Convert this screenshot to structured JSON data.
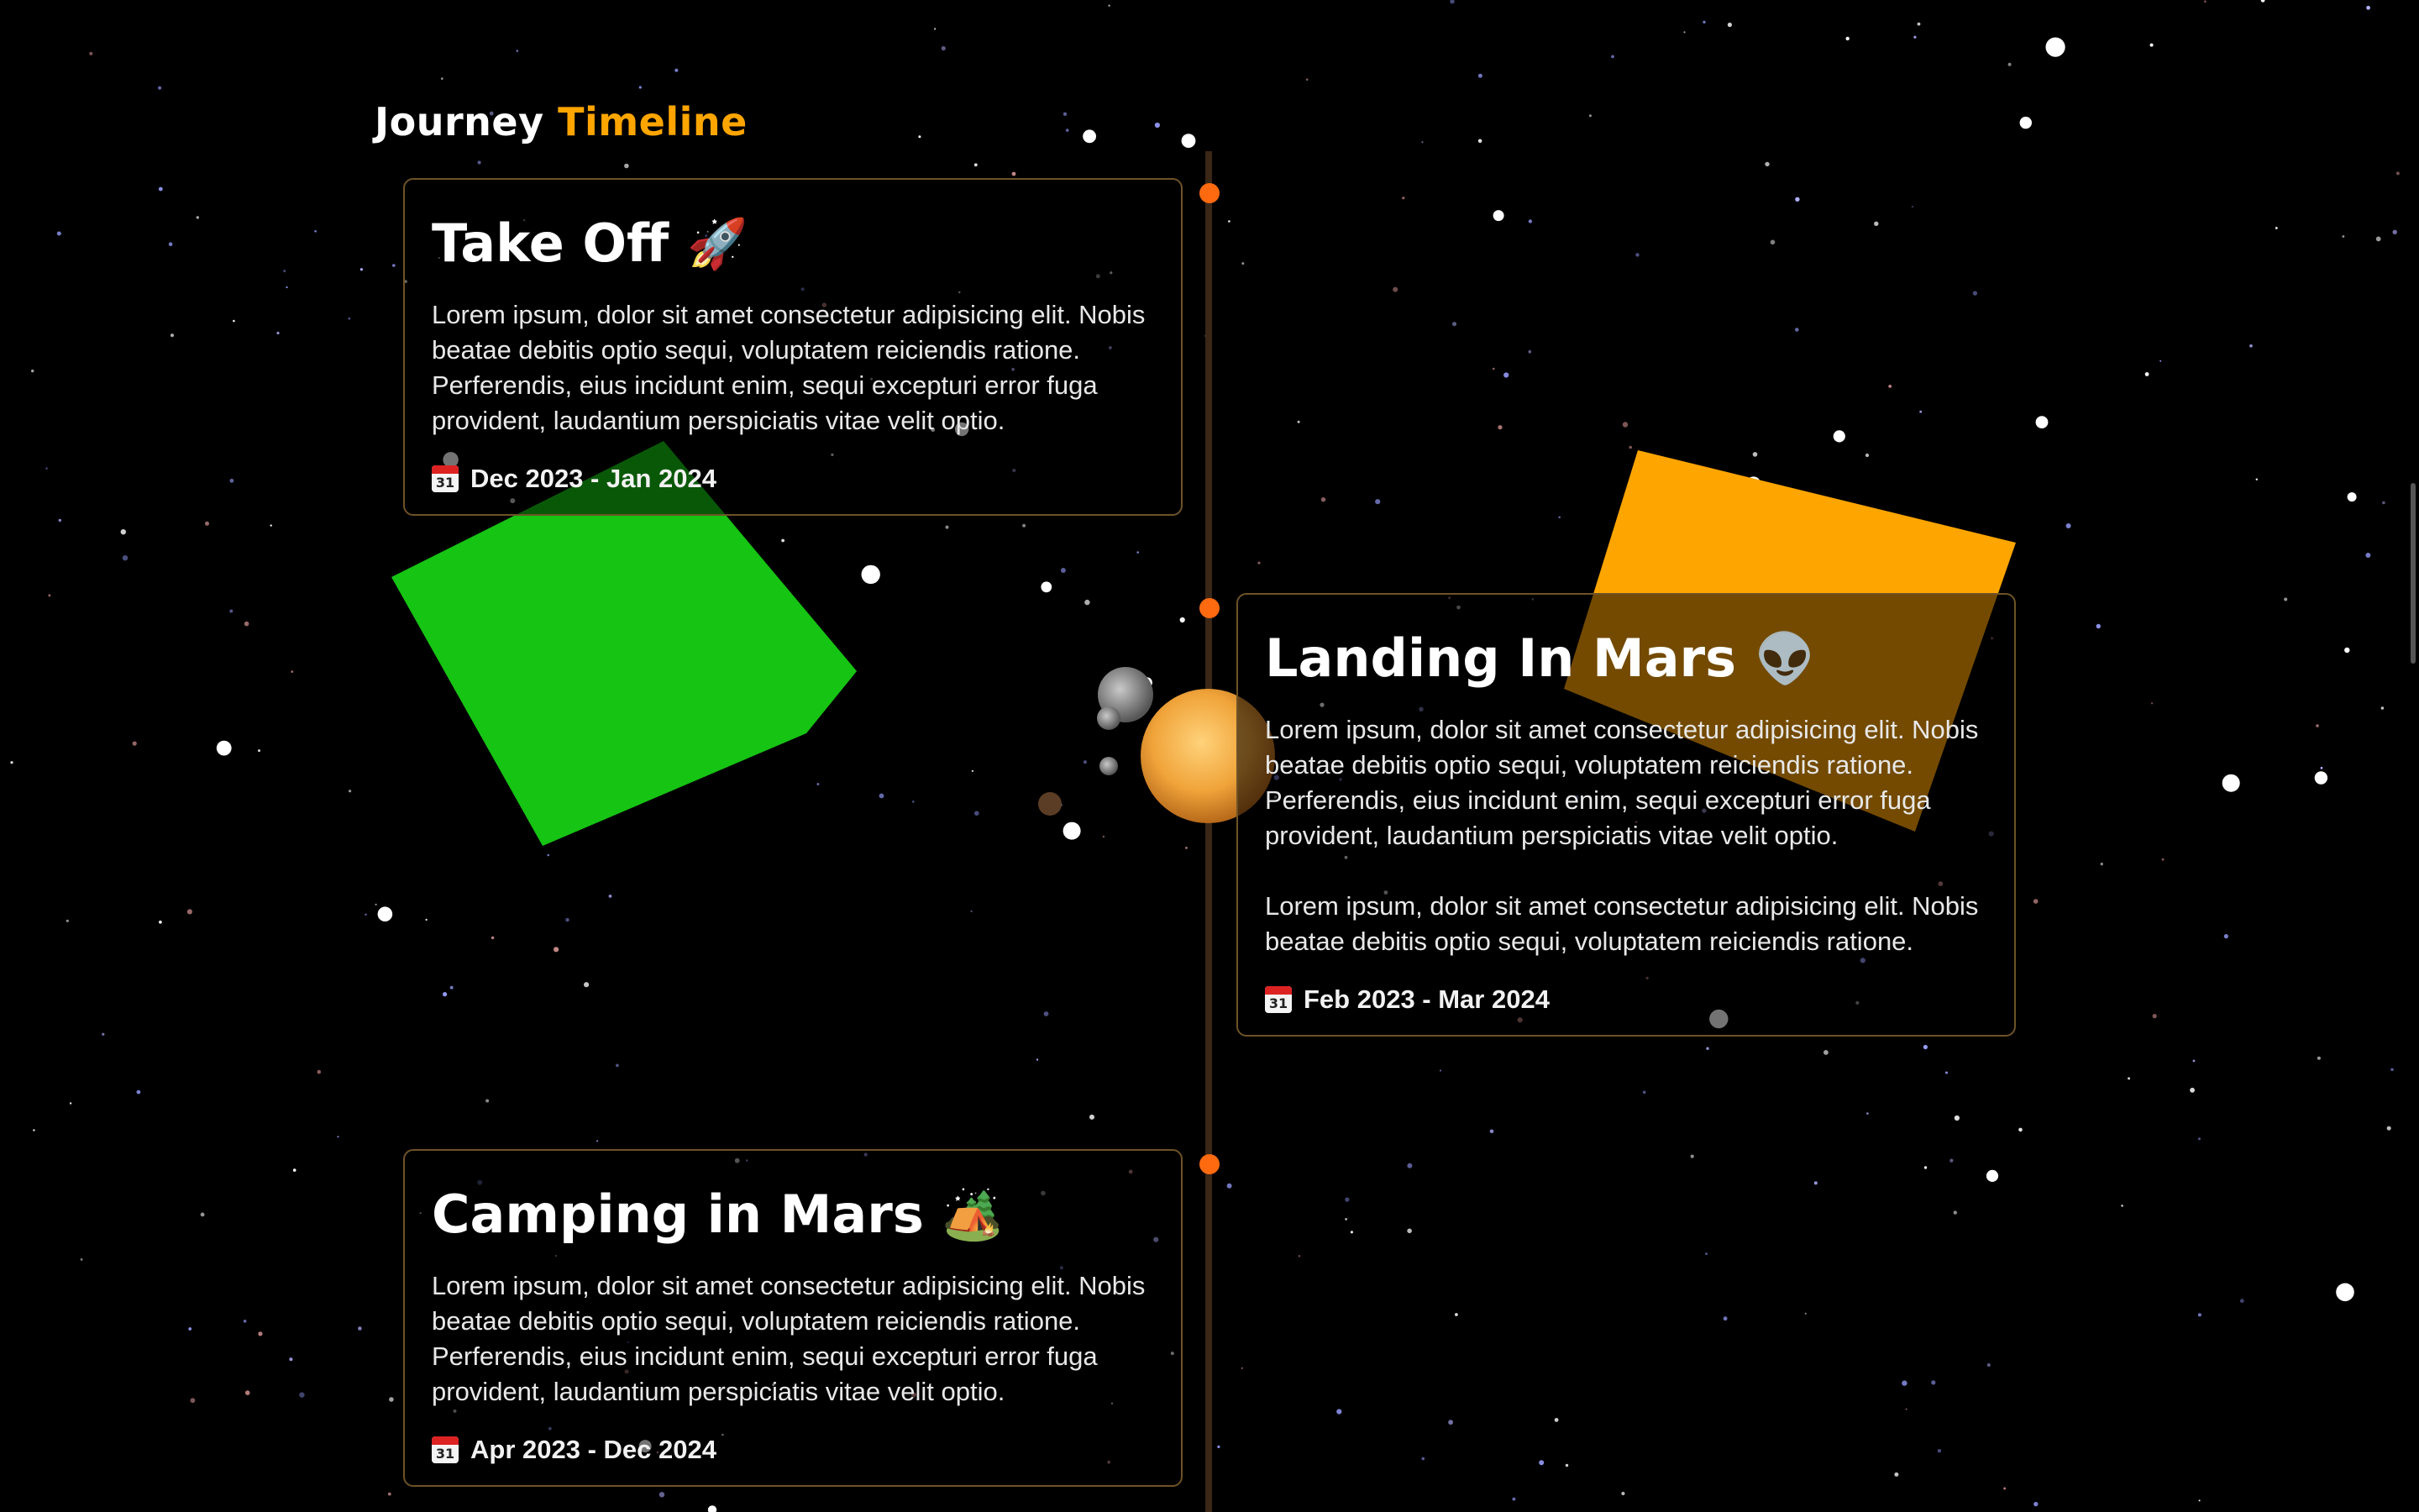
{
  "title": {
    "main": "Journey",
    "accent": "Timeline"
  },
  "colors": {
    "accent": "#ffa500",
    "dot": "#ff6a10",
    "green_shape": "#16c413",
    "orange_shape": "#ffa500",
    "card_border": "#6e5327"
  },
  "entries": [
    {
      "title": "Take Off",
      "emoji": "🚀",
      "paragraphs": [
        "Lorem ipsum, dolor sit amet consectetur adipisicing elit. Nobis beatae debitis optio sequi, voluptatem reiciendis ratione. Perferendis, eius incidunt enim, sequi excepturi error fuga provident, laudantium perspiciatis vitae velit optio."
      ],
      "date": "Dec 2023 - Jan 2024",
      "date_icon": "calendar-icon"
    },
    {
      "title": "Landing In Mars",
      "emoji": "👽",
      "paragraphs": [
        "Lorem ipsum, dolor sit amet consectetur adipisicing elit. Nobis beatae debitis optio sequi, voluptatem reiciendis ratione. Perferendis, eius incidunt enim, sequi excepturi error fuga provident, laudantium perspiciatis vitae velit optio.",
        "Lorem ipsum, dolor sit amet consectetur adipisicing elit. Nobis beatae debitis optio sequi, voluptatem reiciendis ratione."
      ],
      "date": "Feb 2023 - Mar 2024",
      "date_icon": "calendar-icon"
    },
    {
      "title": "Camping in Mars",
      "emoji": "🏕️",
      "paragraphs": [
        "Lorem ipsum, dolor sit amet consectetur adipisicing elit. Nobis beatae debitis optio sequi, voluptatem reiciendis ratione. Perferendis, eius incidunt enim, sequi excepturi error fuga provident, laudantium perspiciatis vitae velit optio."
      ],
      "date": "Apr 2023 - Dec 2024",
      "date_icon": "calendar-icon"
    }
  ],
  "calendar_icon_text": "31"
}
